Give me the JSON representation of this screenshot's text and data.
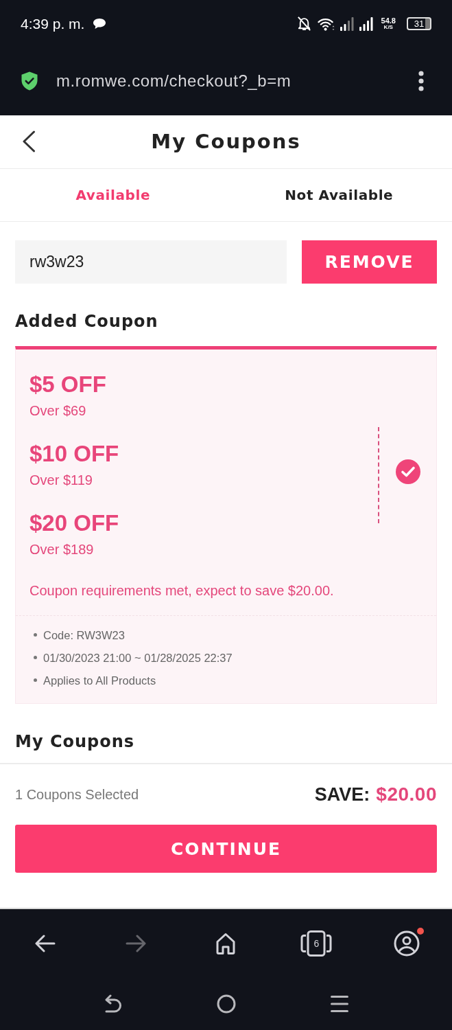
{
  "status_bar": {
    "time": "4:39 p. m.",
    "network_speed": "54.8",
    "network_speed_unit": "K/S",
    "battery": "31"
  },
  "browser": {
    "url": "m.romwe.com/checkout?_b=m"
  },
  "header": {
    "title": "My Coupons"
  },
  "tabs": [
    {
      "label": "Available",
      "selected": true
    },
    {
      "label": "Not Available",
      "selected": false
    }
  ],
  "coupon_input": {
    "value": "rw3w23",
    "button": "REMOVE"
  },
  "added_coupon": {
    "title": "Added Coupon",
    "coupon": {
      "selected": true,
      "tiers": [
        {
          "discount": "$5 OFF",
          "condition": "Over $69"
        },
        {
          "discount": "$10 OFF",
          "condition": "Over $119"
        },
        {
          "discount": "$20 OFF",
          "condition": "Over $189"
        }
      ],
      "message": "Coupon requirements met, expect to save $20.00.",
      "details": [
        "Code: RW3W23",
        "01/30/2023 21:00 ~ 01/28/2025 22:37",
        "Applies to All Products"
      ]
    }
  },
  "my_coupons": {
    "title": "My Coupons"
  },
  "footer": {
    "selected_count": "1 Coupons Selected",
    "save_label": "SAVE:",
    "save_amount": "$20.00",
    "button": "CONTINUE"
  },
  "browser_nav": {
    "tab_count": "6",
    "forward_disabled": true,
    "account_badge": true
  }
}
